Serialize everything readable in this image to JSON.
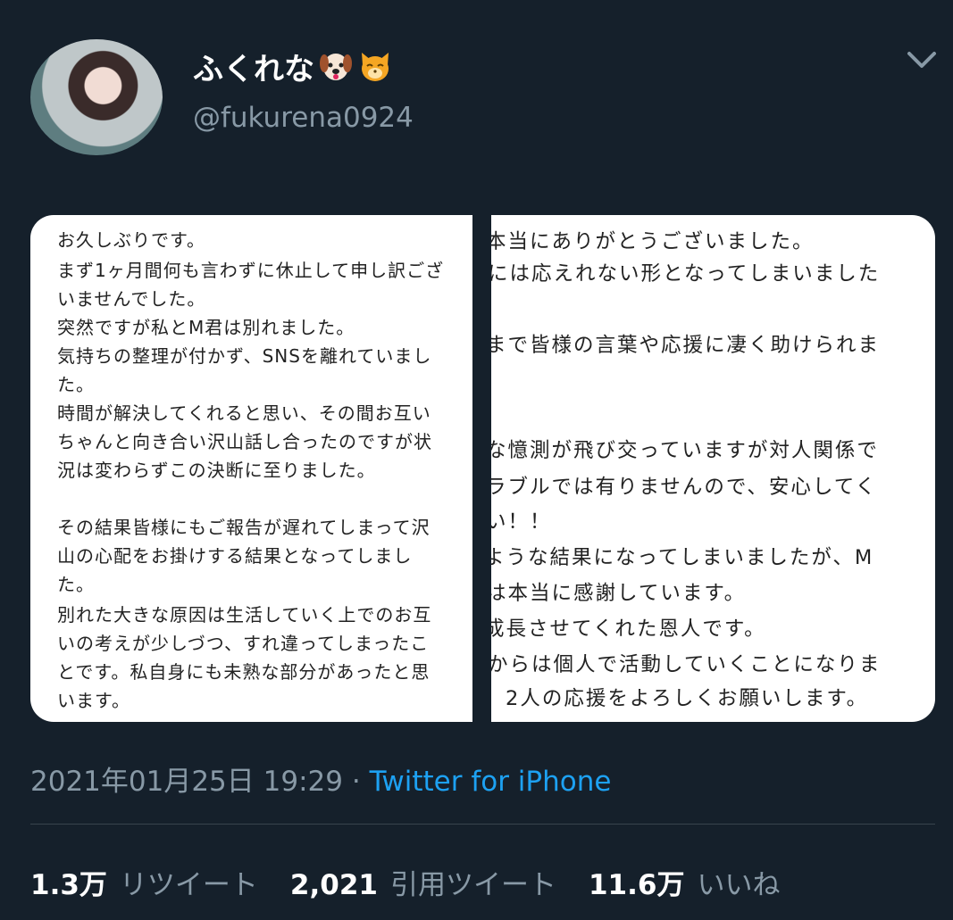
{
  "profile": {
    "display_name": "ふくれな",
    "handle": "@fukurena0924"
  },
  "icons": [
    "dog-face-icon",
    "cat-face-icon",
    "chevron-down-icon"
  ],
  "media": {
    "left_lines": [
      "お久しぶりです。",
      "まず1ヶ月間何も言わずに休止して申し訳ござ",
      "いませんでした。",
      "突然ですが私とM君は別れました。",
      "気持ちの整理が付かず、SNSを離れていまし",
      "た。",
      "時間が解決してくれると思い、その間お互い",
      "ちゃんと向き合い沢山話し合ったのですが状",
      "況は変わらずこの決断に至りました。",
      "",
      "その結果皆様にもご報告が遅れてしまって沢",
      "山の心配をお掛けする結果となってしまし",
      "た。",
      "別れた大きな原因は生活していく上でのお互",
      "いの考えが少しづつ、すれ違ってしまったこ",
      "とです。私自身にも未熟な部分があったと思",
      "います。"
    ],
    "right_lines": [
      "本当にありがとうございました。",
      "には応えれない形となってしまいました",
      "",
      "まで皆様の言葉や応援に凄く助けられま",
      "",
      "",
      "な憶測が飛び交っていますが対人関係で",
      "ラブルでは有りませんので、安心してく",
      "い！！",
      "ような結果になってしまいましたが、M",
      "は本当に感謝しています。",
      "成長させてくれた恩人です。",
      "からは個人で活動していくことになりま",
      "2人の応援をよろしくお願いします。"
    ]
  },
  "meta": {
    "timestamp": "2021年01月25日 19:29",
    "separator": "·",
    "source": "Twitter for iPhone"
  },
  "stats": {
    "retweets_value": "1.3万",
    "retweets_label": "リツイート",
    "quotes_value": "2,021",
    "quotes_label": "引用ツイート",
    "likes_value": "11.6万",
    "likes_label": "いいね"
  },
  "colors": {
    "background": "#15202b",
    "secondary_text": "#8899a6",
    "link": "#1da1f2"
  }
}
